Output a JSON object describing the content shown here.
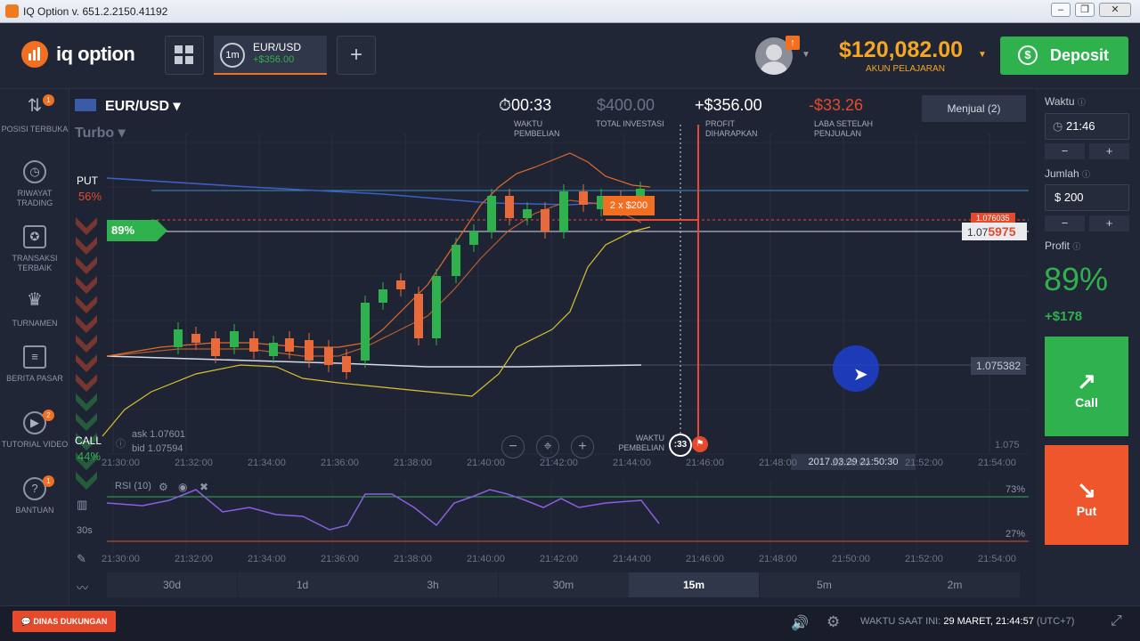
{
  "window": {
    "title": "IQ Option v. 651.2.2150.41192",
    "minimize": "‒",
    "restore": "❐",
    "close": "✕"
  },
  "header": {
    "logo": "iq option",
    "grid_icon": "grid-icon",
    "asset_tab": {
      "timeframe": "1m",
      "pair": "EUR/USD",
      "profit": "+$356.00"
    },
    "add_label": "+",
    "notification_count": "↑",
    "balance": "$120,082.00",
    "account_type": "AKUN PELAJARAN",
    "deposit_label": "Deposit"
  },
  "nav": [
    {
      "label": "POSISI TERBUKA",
      "icon": "arrows-updown-icon",
      "badge": "1"
    },
    {
      "label": "RIWAYAT TRADING",
      "icon": "history-icon",
      "badge": ""
    },
    {
      "label": "TRANSAKSI TERBAIK",
      "icon": "medal-icon",
      "badge": ""
    },
    {
      "label": "TURNAMEN",
      "icon": "trophy-icon",
      "badge": ""
    },
    {
      "label": "BERITA PASAR",
      "icon": "news-icon",
      "badge": ""
    },
    {
      "label": "TUTORIAL VIDEO",
      "icon": "play-icon",
      "badge": "2"
    },
    {
      "label": "BANTUAN",
      "icon": "help-icon",
      "badge": "1"
    }
  ],
  "chart_header": {
    "pair": "EUR/USD",
    "mode": "Turbo",
    "purchase_time": "00:33",
    "purchase_time_label": "WAKTU PEMBELIAN",
    "total_investment": "$400.00",
    "total_investment_label": "TOTAL INVESTASI",
    "expected_profit": "+$356.00",
    "expected_profit_label": "PROFIT DIHARAPKAN",
    "profit_after_sale": "-$33.26",
    "profit_after_sale_label": "LABA SETELAH PENJUALAN",
    "sell_button": "Menjual (2)"
  },
  "sentiment": {
    "put_label": "PUT",
    "put_pct": "56%",
    "call_label": "CALL",
    "call_pct": "44%",
    "payout": "89%"
  },
  "quotes": {
    "ask": "ask 1.07601",
    "bid": "bid 1.07594"
  },
  "prices": {
    "current_prefix": "1.07",
    "current_suffix": "5975",
    "strike_top": "1.076035",
    "line_level": "1.075382",
    "axis_low": "1.075"
  },
  "trade_marker": "2 x $200",
  "purchase_marker": {
    "label": "WAKTU PEMBELIAN",
    "countdown": ":33"
  },
  "time_ticks": [
    "21:30:00",
    "21:32:00",
    "21:34:00",
    "21:36:00",
    "21:38:00",
    "21:40:00",
    "21:42:00",
    "21:44:00",
    "21:46:00",
    "21:48:00",
    "21:50:00",
    "21:52:00",
    "21:54:00"
  ],
  "time_ticks_bottom": [
    "21:30:00",
    "21:32:00",
    "21:34:00",
    "21:36:00",
    "21:38:00",
    "21:40:00",
    "21:42:00",
    "21:44:00",
    "21:46:00",
    "21:48:00",
    "21:50:00",
    "21:52:00",
    "21:54:00"
  ],
  "crosshair_time": "2017.03.29 21:50:30",
  "rsi": {
    "label": "RSI (10)",
    "upper": "73%",
    "lower": "27%"
  },
  "candle_interval": "30s",
  "periods": [
    "30d",
    "1d",
    "3h",
    "30m",
    "15m",
    "5m",
    "2m"
  ],
  "active_period": "15m",
  "right_panel": {
    "time_label": "Waktu",
    "time_value": "21:46",
    "amount_label": "Jumlah",
    "amount_value": "$ 200",
    "profit_label": "Profit",
    "profit_pct": "89%",
    "profit_amount": "+$178",
    "call_label": "Call",
    "put_label": "Put",
    "minus": "−",
    "plus": "+"
  },
  "footer": {
    "support": "DINAS DUKUNGAN",
    "now_label": "WAKTU SAAT INI:",
    "now_value": "29 MARET, 21:44:57",
    "tz": "(UTC+7)"
  },
  "colors": {
    "green": "#2fb14d",
    "orange": "#f26f21",
    "red": "#e54a2c",
    "bg": "#1f2434"
  }
}
